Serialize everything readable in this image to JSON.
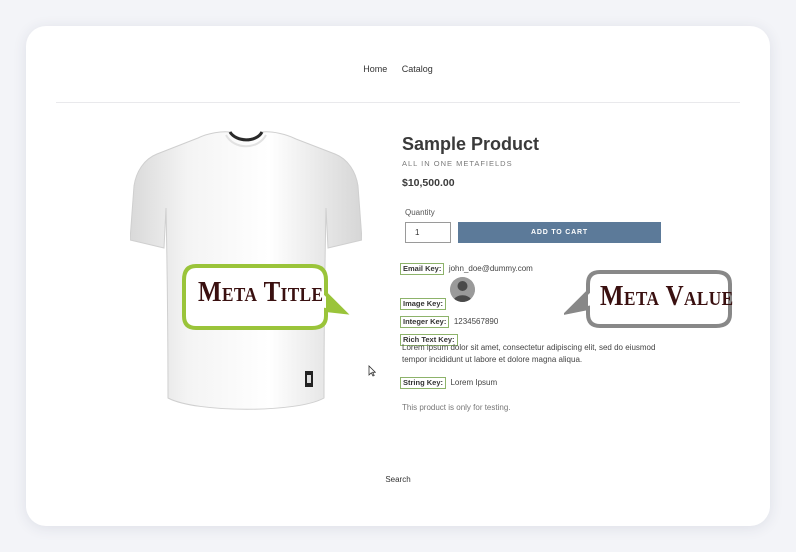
{
  "nav": {
    "items": [
      "Home",
      "Catalog"
    ]
  },
  "product": {
    "title": "Sample Product",
    "vendor": "ALL IN ONE METAFIELDS",
    "price": "$10,500.00",
    "quantity_label": "Quantity",
    "quantity_value": "1",
    "add_to_cart": "ADD TO CART",
    "description": "This product is only for testing."
  },
  "metafields": {
    "email_key": "Email Key:",
    "email_value": "john_doe@dummy.com",
    "image_key": "Image Key:",
    "integer_key": "Integer Key:",
    "integer_value": "1234567890",
    "rich_key": "Rich Text Key:",
    "rich_value": "Lorem ipsum dolor sit amet, consectetur adipiscing elit, sed do eiusmod tempor incididunt ut labore et dolore magna aliqua.",
    "string_key": "String Key:",
    "string_value": "Lorem Ipsum"
  },
  "callouts": {
    "title": "Meta Title",
    "value": "Meta Value",
    "title_color": "#9ac43a",
    "value_color": "#888888"
  },
  "footer": {
    "search": "Search"
  },
  "colors": {
    "accent_button": "#5c7a99",
    "key_border": "#8db36a",
    "background": "#f3f4f8"
  },
  "icons": {
    "product_image": "white-tshirt-image",
    "avatar": "user-avatar-icon",
    "cursor": "mouse-pointer-icon"
  }
}
